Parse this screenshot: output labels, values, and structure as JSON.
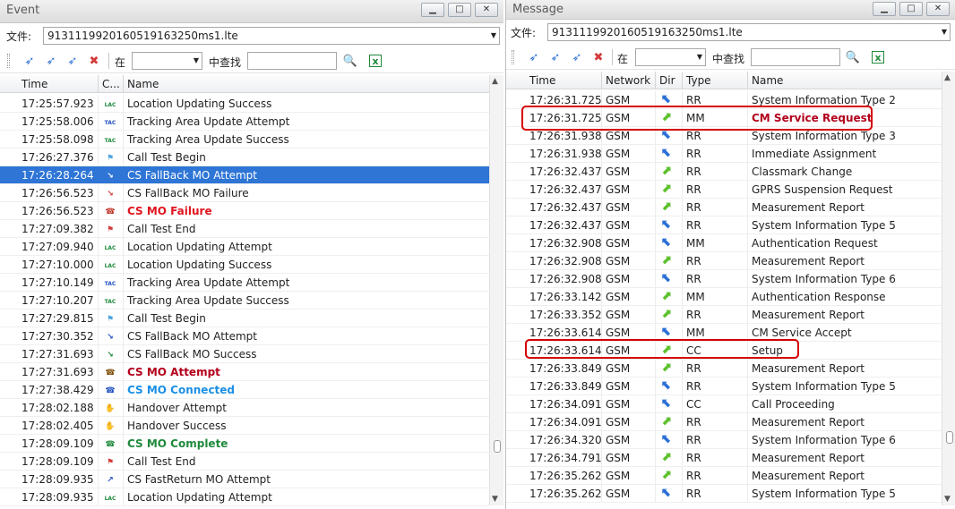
{
  "event_panel": {
    "title": "Event",
    "file_label": "文件:",
    "file_value": "9131119920160519163250ms1.lte",
    "toolbar": {
      "in_label": "在",
      "find_label": "中查找",
      "filter_value": "",
      "search_value": ""
    },
    "columns": [
      "Time",
      "C...",
      "Name"
    ],
    "rows": [
      {
        "time": "17:25:57.923",
        "icon": "lac-icon",
        "name": "Location Updating Success",
        "style": "normal"
      },
      {
        "time": "17:25:58.006",
        "icon": "tac-icon",
        "name": "Tracking Area Update Attempt",
        "style": "normal"
      },
      {
        "time": "17:25:58.098",
        "icon": "tac-success-icon",
        "name": "Tracking Area Update Success",
        "style": "normal"
      },
      {
        "time": "17:26:27.376",
        "icon": "flag-blue-icon",
        "name": "Call Test Begin",
        "style": "normal"
      },
      {
        "time": "17:26:28.264",
        "icon": "fallback-icon",
        "name": "CS FallBack MO Attempt",
        "style": "selected"
      },
      {
        "time": "17:26:56.523",
        "icon": "fallback-fail-icon",
        "name": "CS FallBack MO Failure",
        "style": "normal"
      },
      {
        "time": "17:26:56.523",
        "icon": "phone-fail-icon",
        "name": "CS MO Failure",
        "style": "red"
      },
      {
        "time": "17:27:09.382",
        "icon": "flag-red-icon",
        "name": "Call Test End",
        "style": "normal"
      },
      {
        "time": "17:27:09.940",
        "icon": "lac-icon",
        "name": "Location Updating Attempt",
        "style": "normal"
      },
      {
        "time": "17:27:10.000",
        "icon": "lac-icon",
        "name": "Location Updating Success",
        "style": "normal"
      },
      {
        "time": "17:27:10.149",
        "icon": "tac-icon",
        "name": "Tracking Area Update Attempt",
        "style": "normal"
      },
      {
        "time": "17:27:10.207",
        "icon": "tac-success-icon",
        "name": "Tracking Area Update Success",
        "style": "normal"
      },
      {
        "time": "17:27:29.815",
        "icon": "flag-blue-icon",
        "name": "Call Test Begin",
        "style": "normal"
      },
      {
        "time": "17:27:30.352",
        "icon": "fallback-icon",
        "name": "CS FallBack MO Attempt",
        "style": "normal"
      },
      {
        "time": "17:27:31.693",
        "icon": "fallback-success-icon",
        "name": "CS FallBack MO Success",
        "style": "normal"
      },
      {
        "time": "17:27:31.693",
        "icon": "phone-attempt-icon",
        "name": "CS MO Attempt",
        "style": "darkred"
      },
      {
        "time": "17:27:38.429",
        "icon": "phone-connected-icon",
        "name": "CS MO Connected",
        "style": "blue"
      },
      {
        "time": "17:28:02.188",
        "icon": "hand-icon",
        "name": "Handover Attempt",
        "style": "normal"
      },
      {
        "time": "17:28:02.405",
        "icon": "hand-success-icon",
        "name": "Handover Success",
        "style": "normal"
      },
      {
        "time": "17:28:09.109",
        "icon": "phone-complete-icon",
        "name": "CS MO Complete",
        "style": "green"
      },
      {
        "time": "17:28:09.109",
        "icon": "flag-red-icon",
        "name": "Call Test End",
        "style": "normal"
      },
      {
        "time": "17:28:09.935",
        "icon": "fastreturn-icon",
        "name": "CS FastReturn MO Attempt",
        "style": "normal"
      },
      {
        "time": "17:28:09.935",
        "icon": "lac-icon",
        "name": "Location Updating Attempt",
        "style": "normal"
      }
    ]
  },
  "message_panel": {
    "title": "Message",
    "file_label": "文件:",
    "file_value": "9131119920160519163250ms1.lte",
    "toolbar": {
      "in_label": "在",
      "find_label": "中查找",
      "filter_value": "",
      "search_value": ""
    },
    "columns": [
      "Time",
      "Network",
      "Dir",
      "Type",
      "Name"
    ],
    "rows": [
      {
        "time": "17:26:31.725",
        "network": "GSM",
        "dir": "down",
        "type": "RR",
        "name": "System Information Type 2",
        "style": "normal"
      },
      {
        "time": "17:26:31.725",
        "network": "GSM",
        "dir": "up",
        "type": "MM",
        "name": "CM Service Request",
        "style": "darkred"
      },
      {
        "time": "17:26:31.938",
        "network": "GSM",
        "dir": "down",
        "type": "RR",
        "name": "System Information Type 3",
        "style": "normal"
      },
      {
        "time": "17:26:31.938",
        "network": "GSM",
        "dir": "down",
        "type": "RR",
        "name": "Immediate Assignment",
        "style": "normal"
      },
      {
        "time": "17:26:32.437",
        "network": "GSM",
        "dir": "up",
        "type": "RR",
        "name": "Classmark Change",
        "style": "normal"
      },
      {
        "time": "17:26:32.437",
        "network": "GSM",
        "dir": "up",
        "type": "RR",
        "name": "GPRS Suspension Request",
        "style": "normal"
      },
      {
        "time": "17:26:32.437",
        "network": "GSM",
        "dir": "up",
        "type": "RR",
        "name": "Measurement Report",
        "style": "normal"
      },
      {
        "time": "17:26:32.437",
        "network": "GSM",
        "dir": "down",
        "type": "RR",
        "name": "System Information Type 5",
        "style": "normal"
      },
      {
        "time": "17:26:32.908",
        "network": "GSM",
        "dir": "down",
        "type": "MM",
        "name": "Authentication Request",
        "style": "normal"
      },
      {
        "time": "17:26:32.908",
        "network": "GSM",
        "dir": "up",
        "type": "RR",
        "name": "Measurement Report",
        "style": "normal"
      },
      {
        "time": "17:26:32.908",
        "network": "GSM",
        "dir": "down",
        "type": "RR",
        "name": "System Information Type 6",
        "style": "normal"
      },
      {
        "time": "17:26:33.142",
        "network": "GSM",
        "dir": "up",
        "type": "MM",
        "name": "Authentication Response",
        "style": "normal"
      },
      {
        "time": "17:26:33.352",
        "network": "GSM",
        "dir": "up",
        "type": "RR",
        "name": "Measurement Report",
        "style": "normal"
      },
      {
        "time": "17:26:33.614",
        "network": "GSM",
        "dir": "down",
        "type": "MM",
        "name": "CM Service Accept",
        "style": "normal"
      },
      {
        "time": "17:26:33.614",
        "network": "GSM",
        "dir": "up",
        "type": "CC",
        "name": "Setup",
        "style": "normal"
      },
      {
        "time": "17:26:33.849",
        "network": "GSM",
        "dir": "up",
        "type": "RR",
        "name": "Measurement Report",
        "style": "normal"
      },
      {
        "time": "17:26:33.849",
        "network": "GSM",
        "dir": "down",
        "type": "RR",
        "name": "System Information Type 5",
        "style": "normal"
      },
      {
        "time": "17:26:34.091",
        "network": "GSM",
        "dir": "down",
        "type": "CC",
        "name": "Call Proceeding",
        "style": "normal"
      },
      {
        "time": "17:26:34.091",
        "network": "GSM",
        "dir": "up",
        "type": "RR",
        "name": "Measurement Report",
        "style": "normal"
      },
      {
        "time": "17:26:34.320",
        "network": "GSM",
        "dir": "down",
        "type": "RR",
        "name": "System Information Type 6",
        "style": "normal"
      },
      {
        "time": "17:26:34.791",
        "network": "GSM",
        "dir": "up",
        "type": "RR",
        "name": "Measurement Report",
        "style": "normal"
      },
      {
        "time": "17:26:35.262",
        "network": "GSM",
        "dir": "up",
        "type": "RR",
        "name": "Measurement Report",
        "style": "normal"
      },
      {
        "time": "17:26:35.262",
        "network": "GSM",
        "dir": "down",
        "type": "RR",
        "name": "System Information Type 5",
        "style": "normal"
      }
    ]
  },
  "colors": {
    "selected_bg": "#2e75d6",
    "red": "#e0141e",
    "darkred": "#b3001b",
    "blue": "#1a8fe6",
    "green": "#1e8a3c",
    "uplink": "#5cc12d",
    "downlink": "#2b6fd6",
    "highlight": "#d60000"
  }
}
